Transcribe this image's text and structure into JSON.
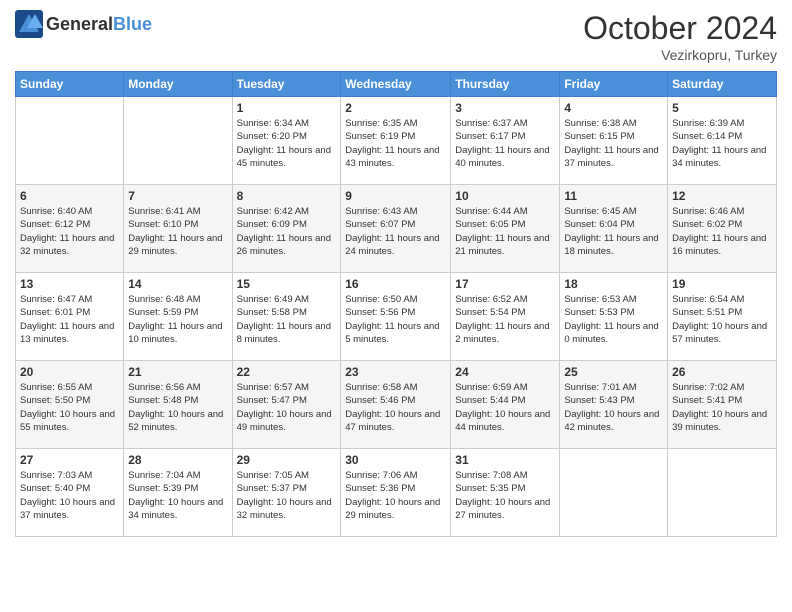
{
  "header": {
    "logo": {
      "general": "General",
      "blue": "Blue"
    },
    "title": "October 2024",
    "location": "Vezirkopru, Turkey"
  },
  "days_of_week": [
    "Sunday",
    "Monday",
    "Tuesday",
    "Wednesday",
    "Thursday",
    "Friday",
    "Saturday"
  ],
  "weeks": [
    [
      {
        "day": "",
        "info": ""
      },
      {
        "day": "",
        "info": ""
      },
      {
        "day": "1",
        "info": "Sunrise: 6:34 AM\nSunset: 6:20 PM\nDaylight: 11 hours and 45 minutes."
      },
      {
        "day": "2",
        "info": "Sunrise: 6:35 AM\nSunset: 6:19 PM\nDaylight: 11 hours and 43 minutes."
      },
      {
        "day": "3",
        "info": "Sunrise: 6:37 AM\nSunset: 6:17 PM\nDaylight: 11 hours and 40 minutes."
      },
      {
        "day": "4",
        "info": "Sunrise: 6:38 AM\nSunset: 6:15 PM\nDaylight: 11 hours and 37 minutes."
      },
      {
        "day": "5",
        "info": "Sunrise: 6:39 AM\nSunset: 6:14 PM\nDaylight: 11 hours and 34 minutes."
      }
    ],
    [
      {
        "day": "6",
        "info": "Sunrise: 6:40 AM\nSunset: 6:12 PM\nDaylight: 11 hours and 32 minutes."
      },
      {
        "day": "7",
        "info": "Sunrise: 6:41 AM\nSunset: 6:10 PM\nDaylight: 11 hours and 29 minutes."
      },
      {
        "day": "8",
        "info": "Sunrise: 6:42 AM\nSunset: 6:09 PM\nDaylight: 11 hours and 26 minutes."
      },
      {
        "day": "9",
        "info": "Sunrise: 6:43 AM\nSunset: 6:07 PM\nDaylight: 11 hours and 24 minutes."
      },
      {
        "day": "10",
        "info": "Sunrise: 6:44 AM\nSunset: 6:05 PM\nDaylight: 11 hours and 21 minutes."
      },
      {
        "day": "11",
        "info": "Sunrise: 6:45 AM\nSunset: 6:04 PM\nDaylight: 11 hours and 18 minutes."
      },
      {
        "day": "12",
        "info": "Sunrise: 6:46 AM\nSunset: 6:02 PM\nDaylight: 11 hours and 16 minutes."
      }
    ],
    [
      {
        "day": "13",
        "info": "Sunrise: 6:47 AM\nSunset: 6:01 PM\nDaylight: 11 hours and 13 minutes."
      },
      {
        "day": "14",
        "info": "Sunrise: 6:48 AM\nSunset: 5:59 PM\nDaylight: 11 hours and 10 minutes."
      },
      {
        "day": "15",
        "info": "Sunrise: 6:49 AM\nSunset: 5:58 PM\nDaylight: 11 hours and 8 minutes."
      },
      {
        "day": "16",
        "info": "Sunrise: 6:50 AM\nSunset: 5:56 PM\nDaylight: 11 hours and 5 minutes."
      },
      {
        "day": "17",
        "info": "Sunrise: 6:52 AM\nSunset: 5:54 PM\nDaylight: 11 hours and 2 minutes."
      },
      {
        "day": "18",
        "info": "Sunrise: 6:53 AM\nSunset: 5:53 PM\nDaylight: 11 hours and 0 minutes."
      },
      {
        "day": "19",
        "info": "Sunrise: 6:54 AM\nSunset: 5:51 PM\nDaylight: 10 hours and 57 minutes."
      }
    ],
    [
      {
        "day": "20",
        "info": "Sunrise: 6:55 AM\nSunset: 5:50 PM\nDaylight: 10 hours and 55 minutes."
      },
      {
        "day": "21",
        "info": "Sunrise: 6:56 AM\nSunset: 5:48 PM\nDaylight: 10 hours and 52 minutes."
      },
      {
        "day": "22",
        "info": "Sunrise: 6:57 AM\nSunset: 5:47 PM\nDaylight: 10 hours and 49 minutes."
      },
      {
        "day": "23",
        "info": "Sunrise: 6:58 AM\nSunset: 5:46 PM\nDaylight: 10 hours and 47 minutes."
      },
      {
        "day": "24",
        "info": "Sunrise: 6:59 AM\nSunset: 5:44 PM\nDaylight: 10 hours and 44 minutes."
      },
      {
        "day": "25",
        "info": "Sunrise: 7:01 AM\nSunset: 5:43 PM\nDaylight: 10 hours and 42 minutes."
      },
      {
        "day": "26",
        "info": "Sunrise: 7:02 AM\nSunset: 5:41 PM\nDaylight: 10 hours and 39 minutes."
      }
    ],
    [
      {
        "day": "27",
        "info": "Sunrise: 7:03 AM\nSunset: 5:40 PM\nDaylight: 10 hours and 37 minutes."
      },
      {
        "day": "28",
        "info": "Sunrise: 7:04 AM\nSunset: 5:39 PM\nDaylight: 10 hours and 34 minutes."
      },
      {
        "day": "29",
        "info": "Sunrise: 7:05 AM\nSunset: 5:37 PM\nDaylight: 10 hours and 32 minutes."
      },
      {
        "day": "30",
        "info": "Sunrise: 7:06 AM\nSunset: 5:36 PM\nDaylight: 10 hours and 29 minutes."
      },
      {
        "day": "31",
        "info": "Sunrise: 7:08 AM\nSunset: 5:35 PM\nDaylight: 10 hours and 27 minutes."
      },
      {
        "day": "",
        "info": ""
      },
      {
        "day": "",
        "info": ""
      }
    ]
  ]
}
